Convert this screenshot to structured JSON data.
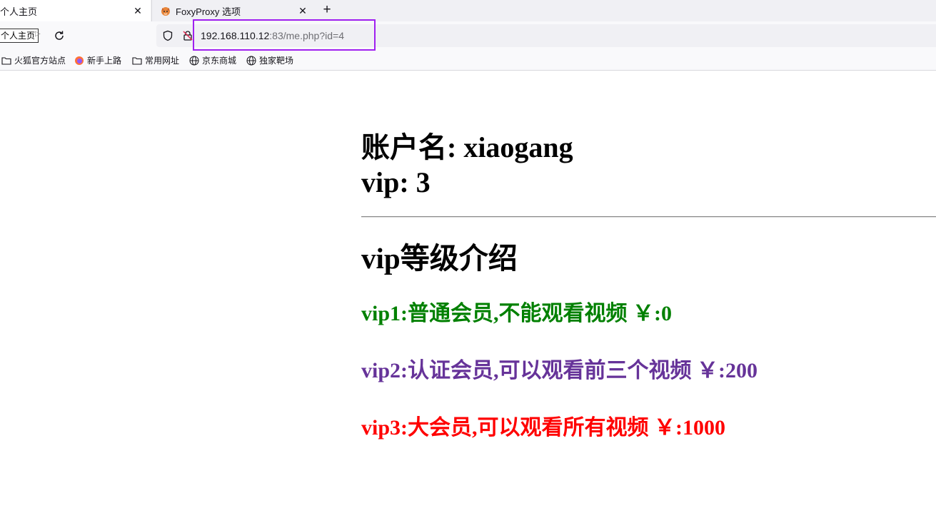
{
  "tabs": [
    {
      "title": "个人主页",
      "close": "✕"
    },
    {
      "title": "FoxyProxy 选项",
      "close": "✕"
    }
  ],
  "new_tab": "+",
  "nav": {
    "home_label": "个人主页",
    "url_host": "192.168.110.12",
    "url_path": ":83/me.php?id=4"
  },
  "bookmarks": [
    {
      "label": "火狐官方站点",
      "icon": "folder-icon"
    },
    {
      "label": "新手上路",
      "icon": "firefox-icon"
    },
    {
      "label": "常用网址",
      "icon": "folder-icon"
    },
    {
      "label": "京东商城",
      "icon": "globe-icon"
    },
    {
      "label": "独家靶场",
      "icon": "globe-icon"
    }
  ],
  "page": {
    "account_line": "账户名: xiaogang",
    "vip_line": "vip: 3",
    "intro_title": "vip等级介绍",
    "levels": [
      {
        "text": "vip1:普通会员,不能观看视频 ￥:0",
        "color": "#008000"
      },
      {
        "text": "vip2:认证会员,可以观看前三个视频 ￥:200",
        "color": "#663399"
      },
      {
        "text": "vip3:大会员,可以观看所有视频 ￥:1000",
        "color": "#ff0000"
      }
    ]
  },
  "colors": {
    "url_highlight": "#a020f0"
  }
}
